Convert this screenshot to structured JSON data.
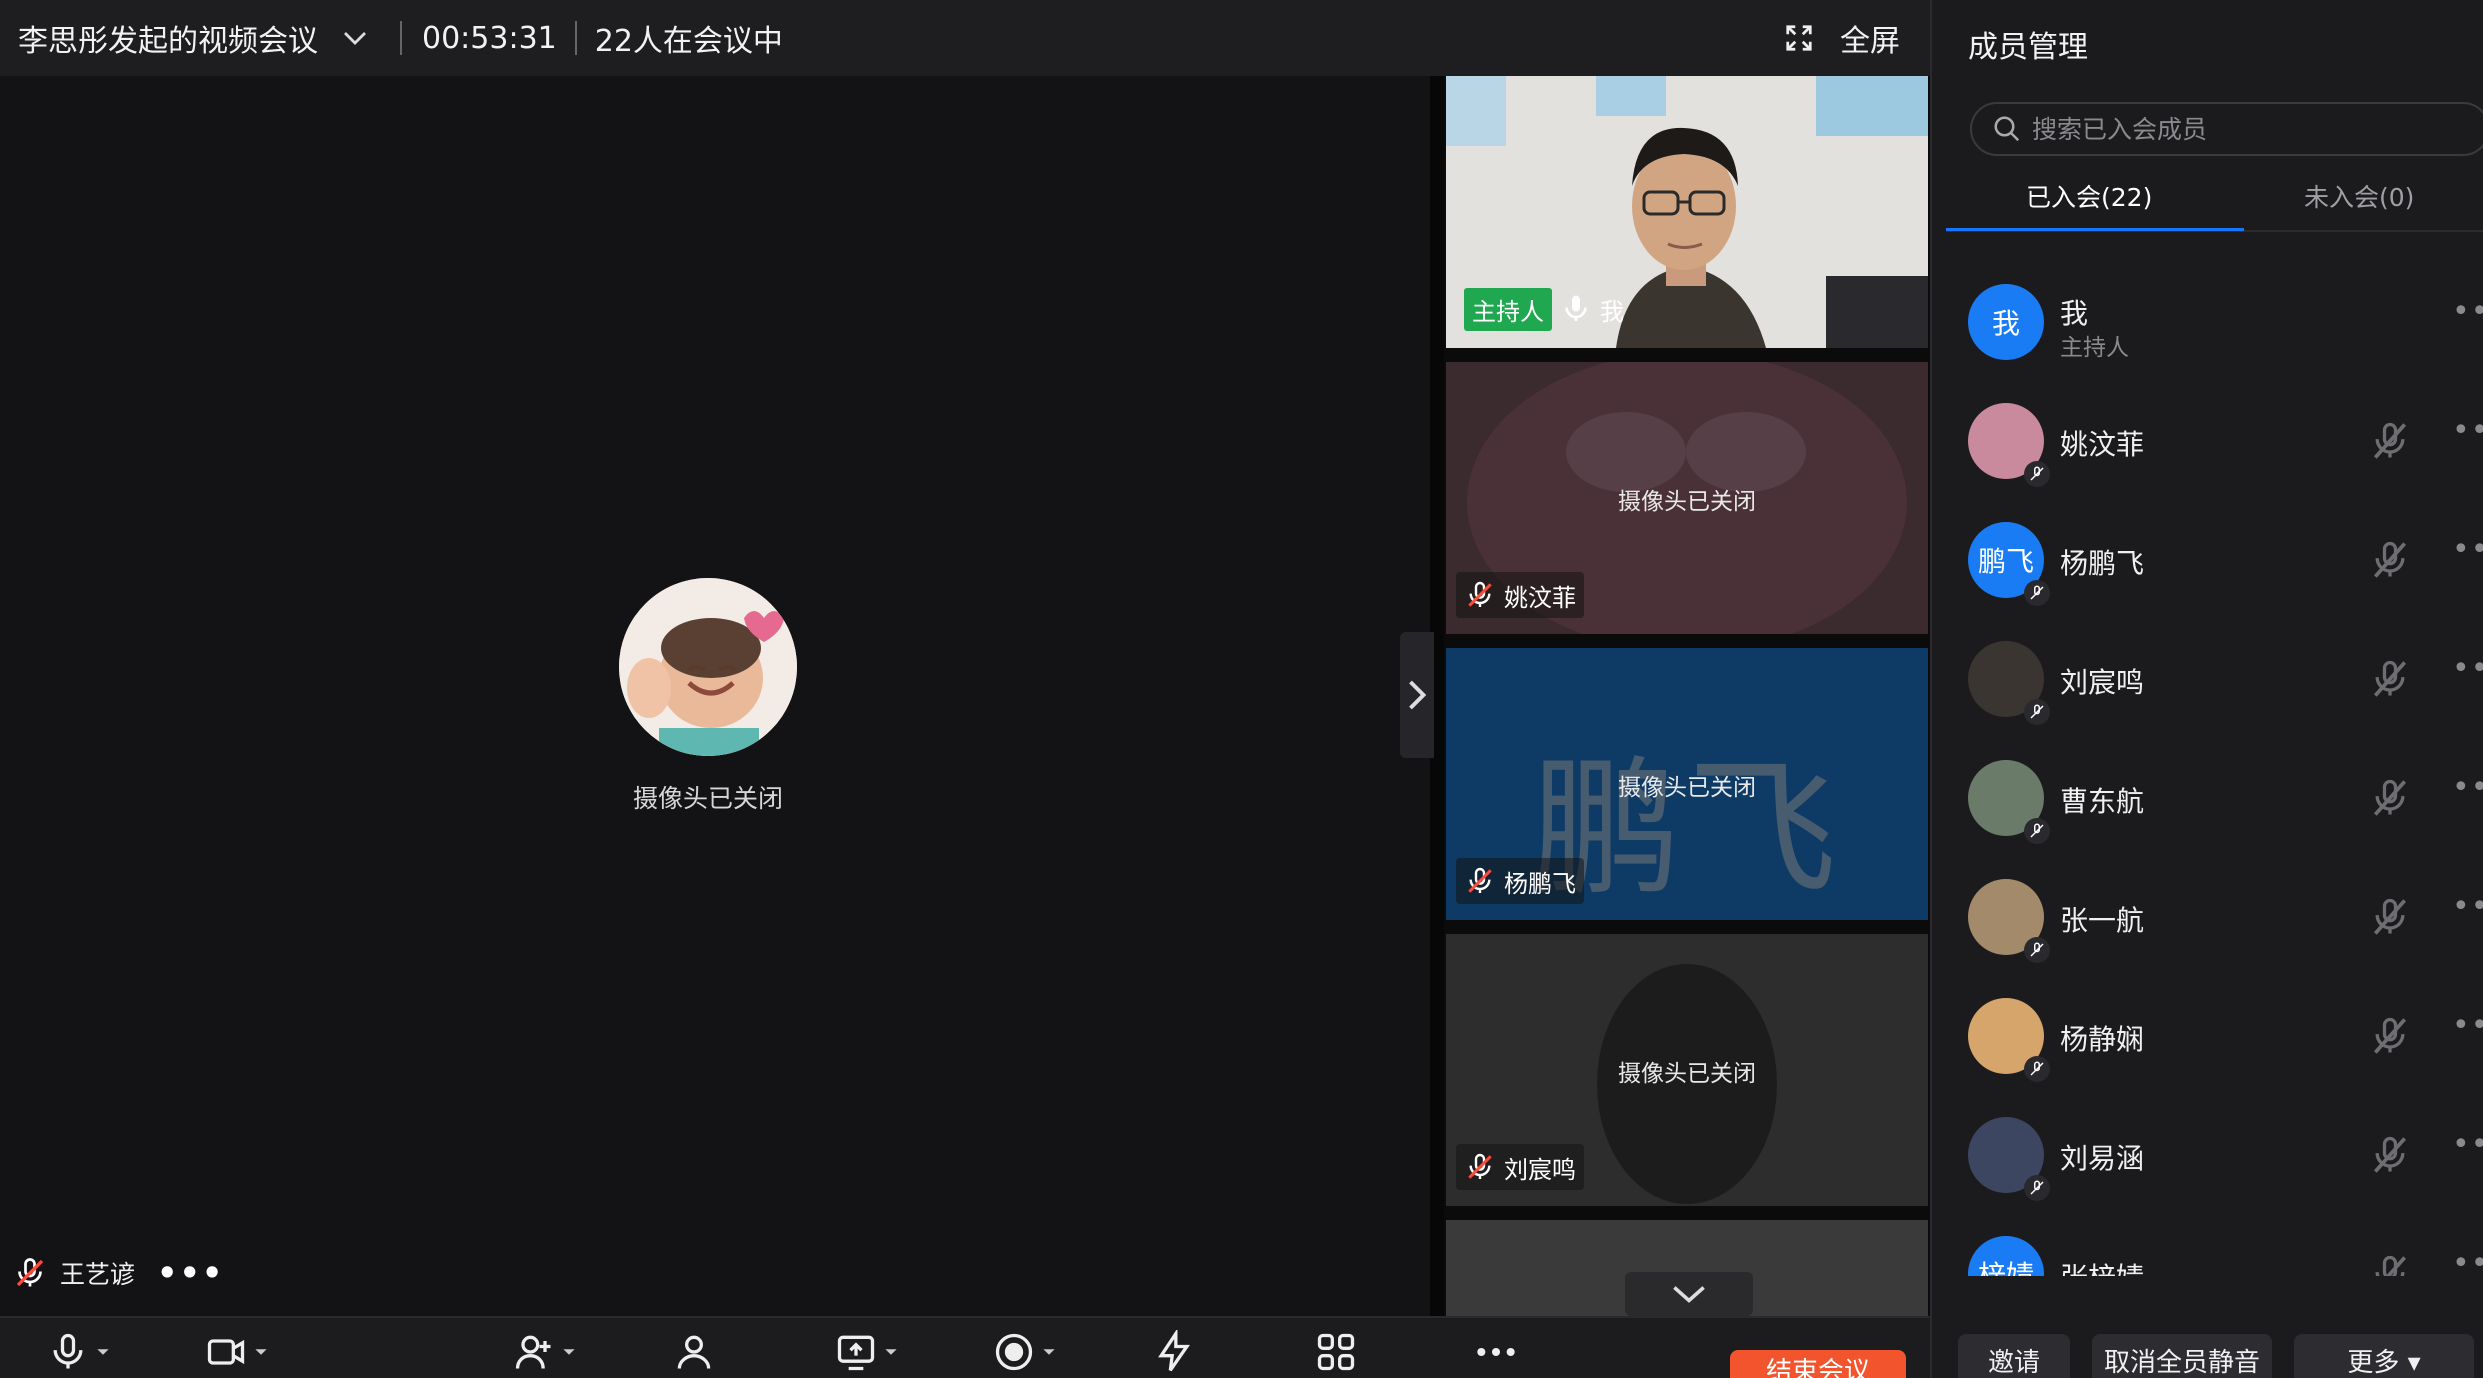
{
  "topbar": {
    "title": "李思彤发起的视频会议",
    "timer": "00:53:31",
    "participants": "22人在会议中",
    "fullscreen_label": "全屏"
  },
  "stage": {
    "camera_off_text": "摄像头已关闭",
    "speaker_name": "王艺谚"
  },
  "thumbnails": [
    {
      "name": "我",
      "host_label": "主持人",
      "camera_on": true
    },
    {
      "name": "姚汶菲",
      "camera_off_text": "摄像头已关闭"
    },
    {
      "name": "杨鹏飞",
      "camera_off_text": "摄像头已关闭",
      "avatar_text": "鹏飞"
    },
    {
      "name": "刘宸鸣",
      "camera_off_text": "摄像头已关闭"
    }
  ],
  "toolbar": {
    "end_button": "结束会议"
  },
  "panel": {
    "title": "成员管理",
    "search_placeholder": "搜索已入会成员",
    "tab_joined": "已入会(22)",
    "tab_not_joined": "未入会(0)",
    "members": [
      {
        "name": "我",
        "role": "主持人",
        "avatar_text": "我",
        "color": "#1a7cf5"
      },
      {
        "name": "姚汶菲",
        "avatar_text": "",
        "color": "#c88a9c"
      },
      {
        "name": "杨鹏飞",
        "avatar_text": "鹏飞",
        "color": "#1a7cf5"
      },
      {
        "name": "刘宸鸣",
        "avatar_text": "",
        "color": "#3a3530"
      },
      {
        "name": "曹东航",
        "avatar_text": "",
        "color": "#6b7b6a"
      },
      {
        "name": "张一航",
        "avatar_text": "",
        "color": "#a38a6a"
      },
      {
        "name": "杨静娴",
        "avatar_text": "",
        "color": "#d5a56c"
      },
      {
        "name": "刘易涵",
        "avatar_text": "",
        "color": "#3c4660"
      },
      {
        "name": "张梓婧",
        "avatar_text": "梓婧",
        "color": "#1a7cf5"
      }
    ],
    "invite_button": "邀请",
    "unmute_all_button": "取消全员静音",
    "more_button": "更多"
  }
}
